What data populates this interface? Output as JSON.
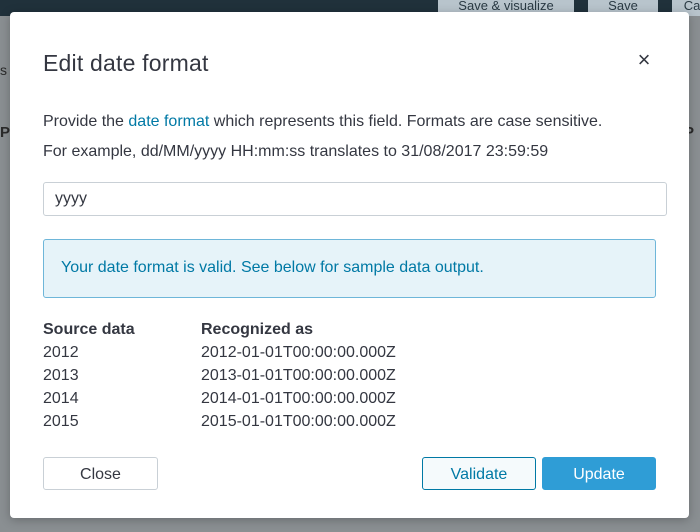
{
  "background": {
    "save_visualize_label": "Save & visualize",
    "save_label": "Save",
    "cancel_label": "Ca",
    "left_glyph": "s",
    "left_glyph2": "P",
    "right_glyph": "P"
  },
  "modal": {
    "title": "Edit date format",
    "close_icon": "×",
    "description": {
      "prefix": "Provide the ",
      "link_text": "date format",
      "suffix": " which represents this field. Formats are case sensitive.",
      "example": "For example, dd/MM/yyyy HH:mm:ss translates to 31/08/2017 23:59:59"
    },
    "format_input": {
      "value": "yyyy",
      "placeholder": ""
    },
    "callout": {
      "text": "Your date format is valid. See below for sample data output."
    },
    "table": {
      "headers": [
        "Source data",
        "Recognized as"
      ],
      "rows": [
        [
          "2012",
          "2012-01-01T00:00:00.000Z"
        ],
        [
          "2013",
          "2013-01-01T00:00:00.000Z"
        ],
        [
          "2014",
          "2014-01-01T00:00:00.000Z"
        ],
        [
          "2015",
          "2015-01-01T00:00:00.000Z"
        ]
      ]
    },
    "buttons": {
      "close": "Close",
      "validate": "Validate",
      "update": "Update"
    }
  },
  "colors": {
    "accent": "#0079a5",
    "primary_button": "#2f9dd6",
    "callout_bg": "#e6f3f9"
  }
}
